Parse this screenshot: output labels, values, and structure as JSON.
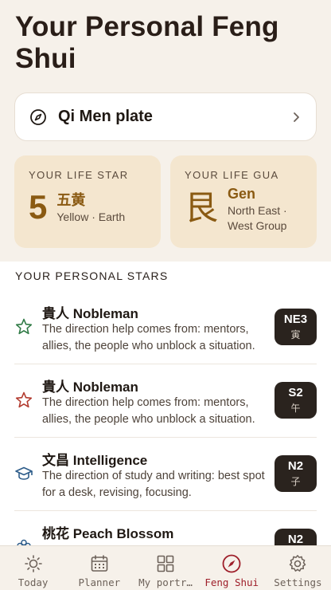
{
  "page": {
    "title": "Your Personal Feng Shui"
  },
  "plate": {
    "label": "Qi Men plate"
  },
  "life_star": {
    "kicker": "YOUR LIFE STAR",
    "number": "5",
    "chinese": "五黄",
    "subtitle": "Yellow · Earth"
  },
  "life_gua": {
    "kicker": "YOUR LIFE GUA",
    "glyph": "艮",
    "name": "Gen",
    "group": "North East · West Group"
  },
  "stars": {
    "section_title": "YOUR PERSONAL STARS",
    "items": [
      {
        "title": "貴人 Nobleman",
        "desc": "The direction help comes from: mentors, allies, the people who unblock a situation.",
        "code": "NE3",
        "branch": "寅",
        "icon": "star-outline-green-icon"
      },
      {
        "title": "貴人 Nobleman",
        "desc": "The direction help comes from: mentors, allies, the people who unblock a situation.",
        "code": "S2",
        "branch": "午",
        "icon": "star-outline-red-icon"
      },
      {
        "title": "文昌 Intelligence",
        "desc": "The direction of study and writing: best spot for a desk, revising, focusing.",
        "code": "N2",
        "branch": "子",
        "icon": "graduation-cap-icon"
      },
      {
        "title": "桃花 Peach Blossom",
        "desc": "",
        "code": "N2",
        "branch": "",
        "icon": "flower-icon"
      }
    ]
  },
  "tabs": [
    {
      "label": "Today",
      "icon": "sun-icon"
    },
    {
      "label": "Planner",
      "icon": "calendar-icon"
    },
    {
      "label": "My portr…",
      "icon": "grid-icon"
    },
    {
      "label": "Feng Shui",
      "icon": "compass-icon",
      "active": true
    },
    {
      "label": "Settings",
      "icon": "gear-icon"
    }
  ],
  "colors": {
    "accent": "#9e1f2a",
    "gold": "#8a5a12",
    "card": "#f4e6cf",
    "background": "#f6f1ea"
  }
}
